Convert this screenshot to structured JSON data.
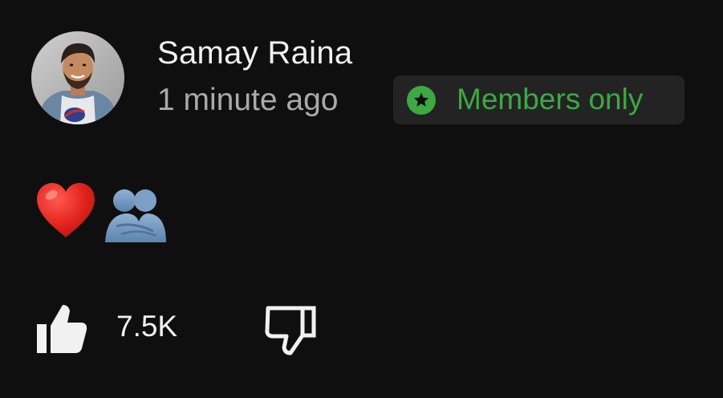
{
  "post": {
    "author": {
      "name": "Samay Raina",
      "avatar_icon": "profile-photo"
    },
    "timestamp": "1 minute ago",
    "badge": {
      "label": "Members only",
      "icon": "star-circle-icon",
      "color": "#3ea843"
    },
    "content": {
      "emojis": [
        "❤️",
        "🫂"
      ]
    },
    "actions": {
      "like_count": "7.5K",
      "like_icon": "thumbs-up-icon",
      "dislike_icon": "thumbs-down-icon"
    }
  },
  "colors": {
    "background": "#0f0f0f",
    "primary_text": "#f1f1f1",
    "secondary_text": "#aaaaaa",
    "badge_background": "#232323",
    "badge_accent": "#3ea843"
  }
}
